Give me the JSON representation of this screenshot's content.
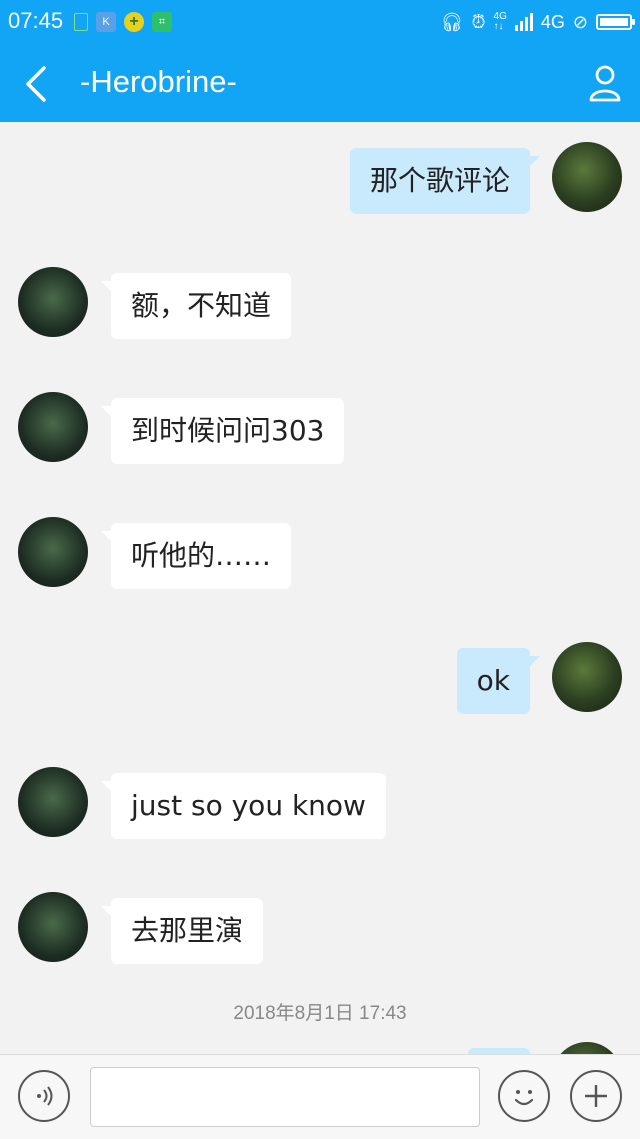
{
  "status_bar": {
    "time": "07:45",
    "network": "4G",
    "colors": {
      "bar": "#12a5f5"
    }
  },
  "header": {
    "title": "-Herobrine-"
  },
  "messages": [
    {
      "dir": "out",
      "text": "那个歌评论"
    },
    {
      "dir": "in",
      "text": "额，不知道"
    },
    {
      "dir": "in",
      "text": "到时候问问303"
    },
    {
      "dir": "in",
      "text": "听他的……"
    },
    {
      "dir": "out",
      "text": "ok"
    },
    {
      "dir": "in",
      "text": "just so you know"
    },
    {
      "dir": "in",
      "text": "去那里演"
    }
  ],
  "timestamp": "2018年8月1日 17:43",
  "composer": {
    "input_value": "",
    "icons": [
      "voice-icon",
      "emoji-icon",
      "plus-icon"
    ]
  }
}
